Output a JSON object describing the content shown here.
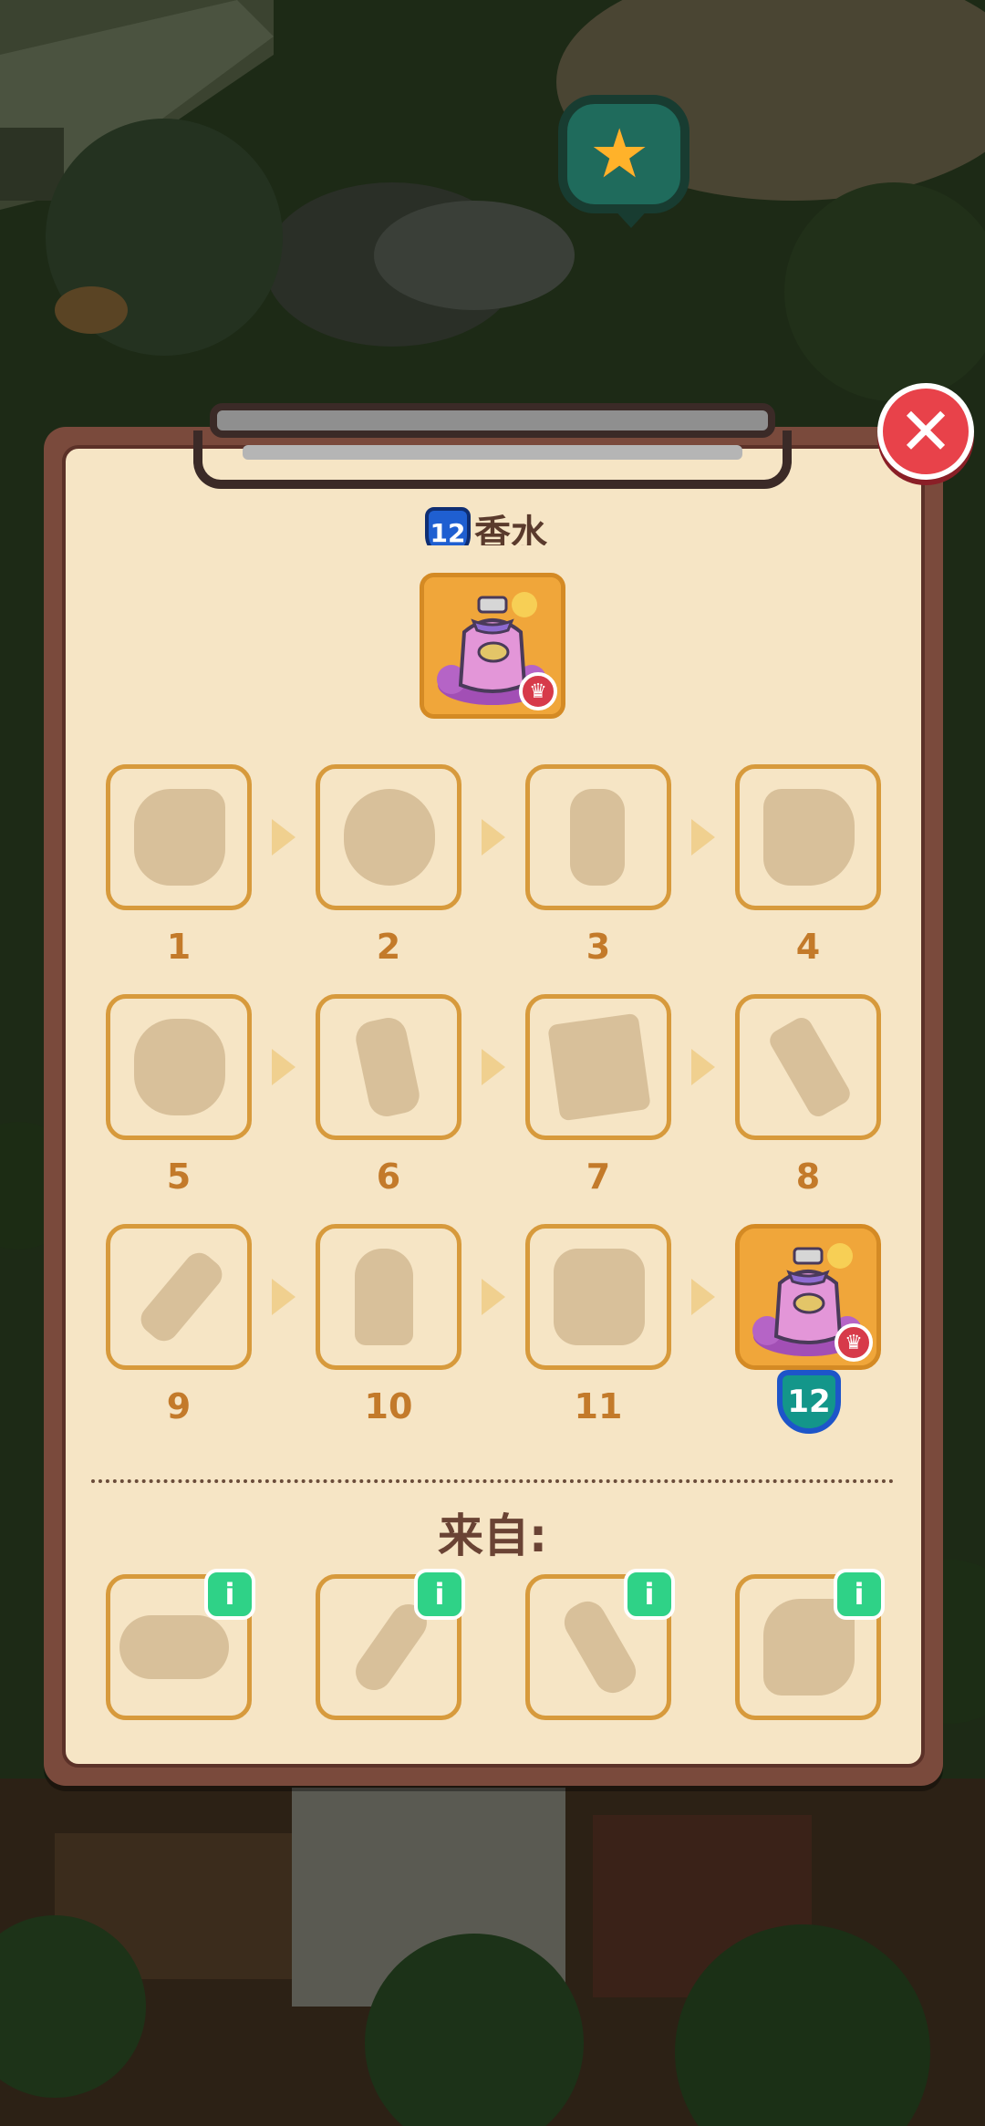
{
  "panel": {
    "title_level": "12",
    "title_text": "香水",
    "close_label": "✕",
    "hero_item": "perfume"
  },
  "chain": {
    "steps": [
      {
        "label": "1",
        "icon": "silhouette-1"
      },
      {
        "label": "2",
        "icon": "silhouette-2"
      },
      {
        "label": "3",
        "icon": "spray-bottle-silhouette"
      },
      {
        "label": "4",
        "icon": "silhouette-4"
      },
      {
        "label": "5",
        "icon": "silhouette-5"
      },
      {
        "label": "6",
        "icon": "silhouette-6"
      },
      {
        "label": "7",
        "icon": "silhouette-7"
      },
      {
        "label": "8",
        "icon": "hammer-silhouette"
      },
      {
        "label": "9",
        "icon": "silhouette-9"
      },
      {
        "label": "10",
        "icon": "silhouette-10"
      },
      {
        "label": "11",
        "icon": "silhouette-11"
      },
      {
        "label": "",
        "icon": "perfume"
      }
    ],
    "final_badge": "12"
  },
  "from": {
    "heading": "来自:",
    "sources": [
      {
        "icon": "source-silhouette-1"
      },
      {
        "icon": "source-silhouette-2"
      },
      {
        "icon": "source-silhouette-3"
      },
      {
        "icon": "source-silhouette-4"
      }
    ],
    "info_label": "i"
  },
  "colors": {
    "panel_bg": "#f6e5c5",
    "panel_border": "#7a4a3c",
    "tile_border": "#d79a3c",
    "number_color": "#c37a2a",
    "close_red": "#e8424a",
    "info_green": "#2fd287"
  }
}
